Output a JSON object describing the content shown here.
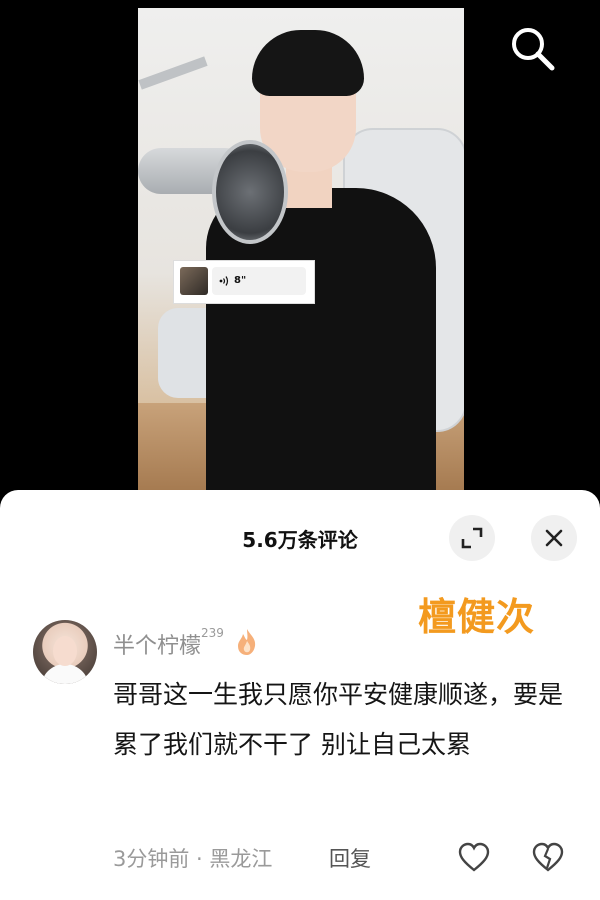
{
  "video": {
    "voice_message": {
      "duration": "8\""
    },
    "icons": {
      "search": "search-icon",
      "voice": "sound-wave-icon"
    }
  },
  "comments_panel": {
    "title": "5.6万条评论",
    "icons": {
      "expand": "expand-icon",
      "close": "close-icon"
    }
  },
  "watermark": "檀健次",
  "comment": {
    "username": "半个柠檬",
    "level": "239",
    "badge_icon": "fire-icon",
    "text": "哥哥这一生我只愿你平安健康顺遂，要是累了我们就不干了  别让自己太累",
    "time_location": "3分钟前 · 黑龙江",
    "reply_label": "回复",
    "icons": {
      "like": "heart-icon",
      "dislike": "broken-heart-icon"
    }
  }
}
